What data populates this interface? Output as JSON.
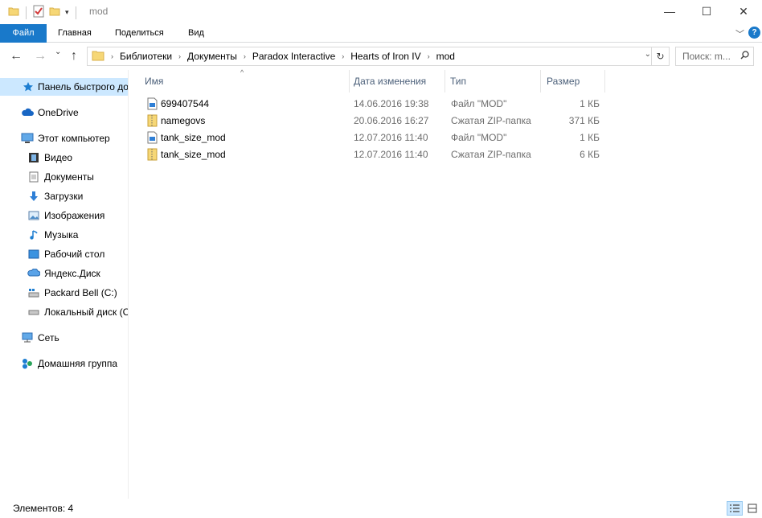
{
  "window": {
    "title": "mod",
    "minimize_glyph": "—",
    "maximize_glyph": "☐",
    "close_glyph": "✕"
  },
  "ribbon": {
    "tabs": [
      "Файл",
      "Главная",
      "Поделиться",
      "Вид"
    ],
    "expand_glyph": "﹀",
    "help_glyph": "?",
    "accent_color": "#1979ca"
  },
  "nav": {
    "back_glyph": "←",
    "forward_glyph": "→",
    "recent_glyph": "⌄",
    "up_glyph": "↑",
    "breadcrumb": [
      "Библиотеки",
      "Документы",
      "Paradox Interactive",
      "Hearts of Iron IV",
      "mod"
    ],
    "crumb_separator": "›",
    "dropdown_glyph": "⌄",
    "refresh_glyph": "↻",
    "search_placeholder": "Поиск: m..."
  },
  "sidebar": {
    "items": [
      {
        "label": "Панель быстрого доступа",
        "icon": "star-icon"
      },
      {
        "label": "OneDrive",
        "icon": "cloud-icon"
      },
      {
        "label": "Этот компьютер",
        "icon": "computer-icon"
      },
      {
        "label": "Видео",
        "icon": "video-icon"
      },
      {
        "label": "Документы",
        "icon": "documents-icon"
      },
      {
        "label": "Загрузки",
        "icon": "download-icon"
      },
      {
        "label": "Изображения",
        "icon": "pictures-icon"
      },
      {
        "label": "Музыка",
        "icon": "music-icon"
      },
      {
        "label": "Рабочий стол",
        "icon": "desktop-icon"
      },
      {
        "label": "Яндекс.Диск",
        "icon": "yandex-disk-icon"
      },
      {
        "label": "Packard Bell (C:)",
        "icon": "system-drive-icon"
      },
      {
        "label": "Локальный диск (C",
        "icon": "drive-icon"
      },
      {
        "label": "Сеть",
        "icon": "network-icon"
      },
      {
        "label": "Домашняя группа",
        "icon": "homegroup-icon"
      }
    ]
  },
  "table": {
    "columns": [
      "Имя",
      "Дата изменения",
      "Тип",
      "Размер"
    ],
    "sort_glyph": "^",
    "rows": [
      {
        "name": "699407544",
        "date": "14.06.2016 19:38",
        "type": "Файл \"MOD\"",
        "size": "1 КБ",
        "icon": "mod-file-icon"
      },
      {
        "name": "namegovs",
        "date": "20.06.2016 16:27",
        "type": "Сжатая ZIP-папка",
        "size": "371 КБ",
        "icon": "zip-folder-icon"
      },
      {
        "name": "tank_size_mod",
        "date": "12.07.2016 11:40",
        "type": "Файл \"MOD\"",
        "size": "1 КБ",
        "icon": "mod-file-icon"
      },
      {
        "name": "tank_size_mod",
        "date": "12.07.2016 11:40",
        "type": "Сжатая ZIP-папка",
        "size": "6 КБ",
        "icon": "zip-folder-icon"
      }
    ]
  },
  "status": {
    "items_count": "Элементов: 4"
  }
}
